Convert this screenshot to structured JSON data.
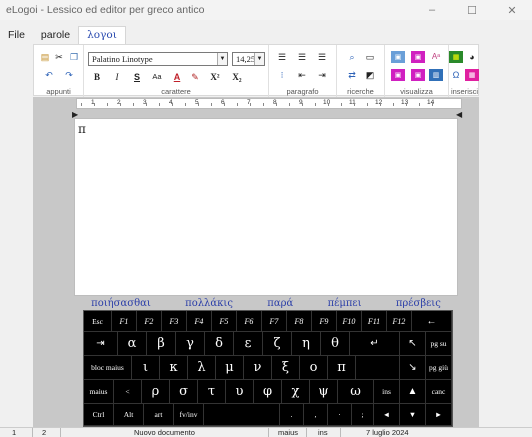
{
  "window": {
    "title": "eLogoi - Lessico ed editor per greco antico",
    "controls": [
      "–",
      "☐",
      "✕"
    ]
  },
  "menu": [
    "File",
    "parole",
    "λογοι"
  ],
  "ribbon": {
    "groups": [
      "appunti",
      "carattere",
      "paragrafo",
      "ricerche",
      "visualizza",
      "inserisci"
    ],
    "font_name": "Palatino Linotype",
    "font_size": "14,25",
    "format_buttons": [
      "B",
      "I",
      "S",
      "Aa",
      "A",
      "X²",
      "X₂"
    ],
    "insert_omega": "Ω"
  },
  "ruler": {
    "labels": [
      "1",
      "2",
      "3",
      "4",
      "5",
      "6",
      "7",
      "8",
      "9",
      "10",
      "11",
      "12",
      "13",
      "14"
    ]
  },
  "document": {
    "text": "π"
  },
  "suggestions": [
    "ποιήσασθαι",
    "πολλάκις",
    "παρά",
    "πέμπει",
    "πρέσβεις"
  ],
  "keyboard": {
    "row1": [
      "Esc",
      "F1",
      "F2",
      "F3",
      "F4",
      "F5",
      "F6",
      "F7",
      "F8",
      "F9",
      "F10",
      "F11",
      "F12",
      "←"
    ],
    "row2": [
      "⇥",
      "α",
      "β",
      "γ",
      "δ",
      "ε",
      "ζ",
      "η",
      "θ",
      "↵",
      "↖",
      "pg su"
    ],
    "row3": [
      "bloc maius",
      "ι",
      "κ",
      "λ",
      "μ",
      "ν",
      "ξ",
      "ο",
      "π",
      "↘",
      "pg giù"
    ],
    "row4": [
      "maius",
      "<",
      "ρ",
      "σ",
      "τ",
      "υ",
      "φ",
      "χ",
      "ψ",
      "ω",
      "ins",
      "▲",
      "canc"
    ],
    "row5": [
      "Ctrl",
      "Alt",
      "art",
      "fv/inv",
      "",
      ".",
      ",",
      "·",
      ";",
      "◄",
      "▼",
      "►"
    ]
  },
  "status": {
    "col": "1",
    "row": "2",
    "doc": "Nuovo documento",
    "caps": "maius",
    "ins": "ins",
    "date": "7 luglio 2024"
  }
}
